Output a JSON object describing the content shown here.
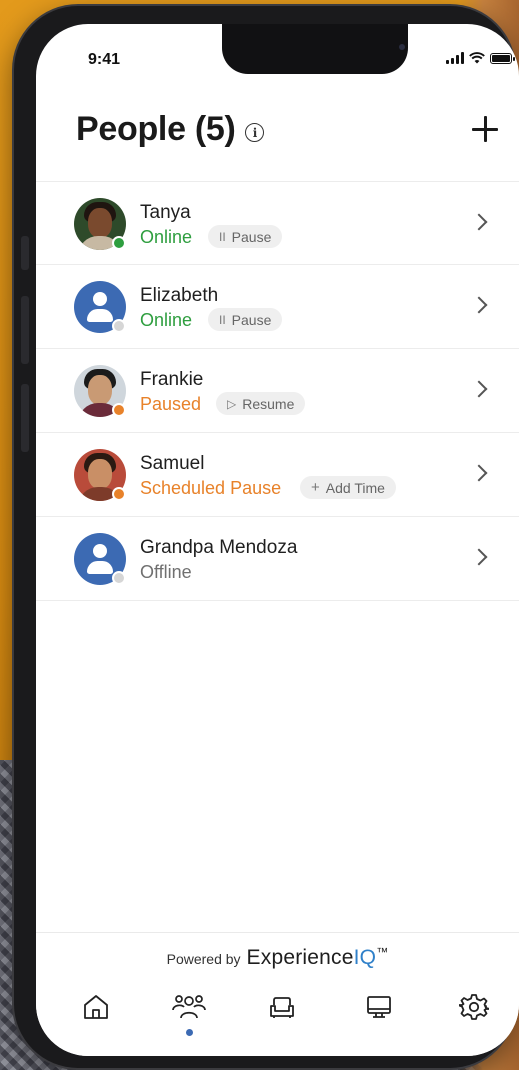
{
  "status_bar": {
    "time": "9:41"
  },
  "header": {
    "title": "People (5)",
    "info_icon": "info-icon",
    "add_icon": "plus-icon"
  },
  "colors": {
    "online": "#2e9e3f",
    "paused": "#e8822a",
    "offline": "#8a8a8a",
    "accent": "#3c6ab3",
    "brand_iq": "#2f80c9"
  },
  "people": [
    {
      "name": "Tanya",
      "status": "Online",
      "status_type": "online",
      "action": "Pause",
      "action_icon": "pause-icon",
      "avatar": "photo"
    },
    {
      "name": "Elizabeth",
      "status": "Online",
      "status_type": "online",
      "action": "Pause",
      "action_icon": "pause-icon",
      "avatar": "default"
    },
    {
      "name": "Frankie",
      "status": "Paused",
      "status_type": "paused",
      "action": "Resume",
      "action_icon": "play-icon",
      "avatar": "photo"
    },
    {
      "name": "Samuel",
      "status": "Scheduled Pause",
      "status_type": "paused",
      "action": "Add Time",
      "action_icon": "plus-icon",
      "avatar": "photo"
    },
    {
      "name": "Grandpa Mendoza",
      "status": "Offline",
      "status_type": "offline",
      "action": "",
      "avatar": "default"
    }
  ],
  "footer": {
    "powered_by": "Powered by",
    "brand": "Experience",
    "brand_suffix": "IQ",
    "trademark": "™"
  },
  "bottom_nav": [
    {
      "icon": "home-icon",
      "active": false
    },
    {
      "icon": "people-icon",
      "active": true
    },
    {
      "icon": "couch-icon",
      "active": false
    },
    {
      "icon": "monitor-icon",
      "active": false
    },
    {
      "icon": "gear-icon",
      "active": false
    }
  ]
}
